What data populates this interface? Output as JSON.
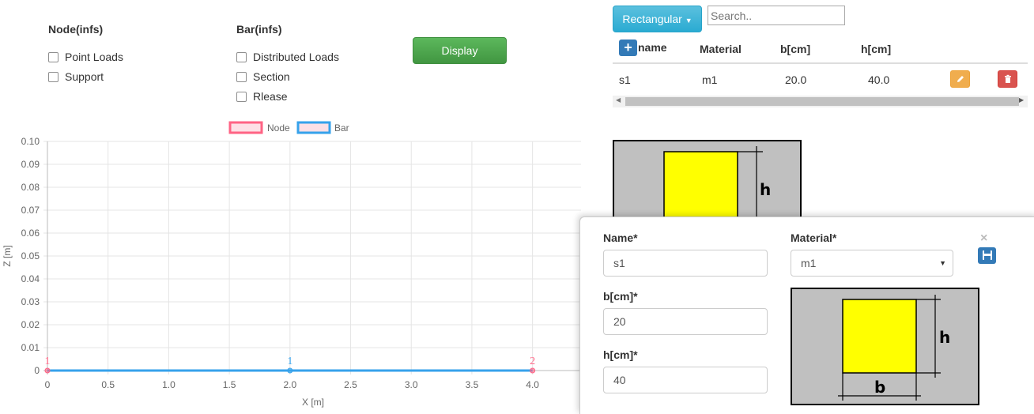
{
  "filters": {
    "node": {
      "title": "Node(infs)",
      "options": [
        {
          "label": "Point Loads",
          "checked": false
        },
        {
          "label": "Support",
          "checked": false
        }
      ]
    },
    "bar": {
      "title": "Bar(infs)",
      "options": [
        {
          "label": "Distributed Loads",
          "checked": false
        },
        {
          "label": "Section",
          "checked": false
        },
        {
          "label": "Rlease",
          "checked": false
        }
      ]
    },
    "display_label": "Display"
  },
  "sections": {
    "type_dropdown_label": "Rectangular",
    "search_placeholder": "Search..",
    "columns": [
      "name",
      "Material",
      "b[cm]",
      "h[cm]"
    ],
    "rows": [
      {
        "name": "s1",
        "material": "m1",
        "b": "20.0",
        "h": "40.0"
      }
    ],
    "preview_labels": {
      "h": "h"
    }
  },
  "chart_data": {
    "type": "scatter",
    "xlabel": "X [m]",
    "ylabel": "Z [m]",
    "xlim": [
      0,
      4
    ],
    "ylim": [
      0,
      0.1
    ],
    "x_ticks": [
      "0",
      "0.5",
      "1.0",
      "1.5",
      "2.0",
      "2.5",
      "3.0",
      "3.5",
      "4.0",
      "4"
    ],
    "y_ticks": [
      "0",
      "0.01",
      "0.02",
      "0.03",
      "0.04",
      "0.05",
      "0.06",
      "0.07",
      "0.08",
      "0.09",
      "0.10"
    ],
    "legend": [
      "Node",
      "Bar"
    ],
    "legend_position": "top",
    "grid": true,
    "series": [
      {
        "name": "Node",
        "color": "#ff6384",
        "points": [
          {
            "x": 0,
            "y": 0,
            "label": "1"
          },
          {
            "x": 4,
            "y": 0,
            "label": "2"
          }
        ]
      },
      {
        "name": "Bar",
        "color": "#36a2eb",
        "line": {
          "x": [
            0,
            4
          ],
          "y": [
            0,
            0
          ]
        },
        "points": [
          {
            "x": 2,
            "y": 0,
            "label": "1"
          }
        ]
      }
    ]
  },
  "edit_form": {
    "name_label": "Name*",
    "name_value": "s1",
    "material_label": "Material*",
    "material_value": "m1",
    "b_label": "b[cm]*",
    "b_value": "20",
    "h_label": "h[cm]*",
    "h_value": "40",
    "close_icon": "×",
    "preview_labels": {
      "h": "h",
      "b": "b"
    }
  },
  "colors": {
    "accent_blue": "#337ab7",
    "display_green": "#5cb85c",
    "info_blue": "#5bc0de",
    "edit_orange": "#f0ad4e",
    "delete_red": "#d9534f",
    "section_fill": "#ffff00",
    "section_bg": "#c0c0c0"
  }
}
